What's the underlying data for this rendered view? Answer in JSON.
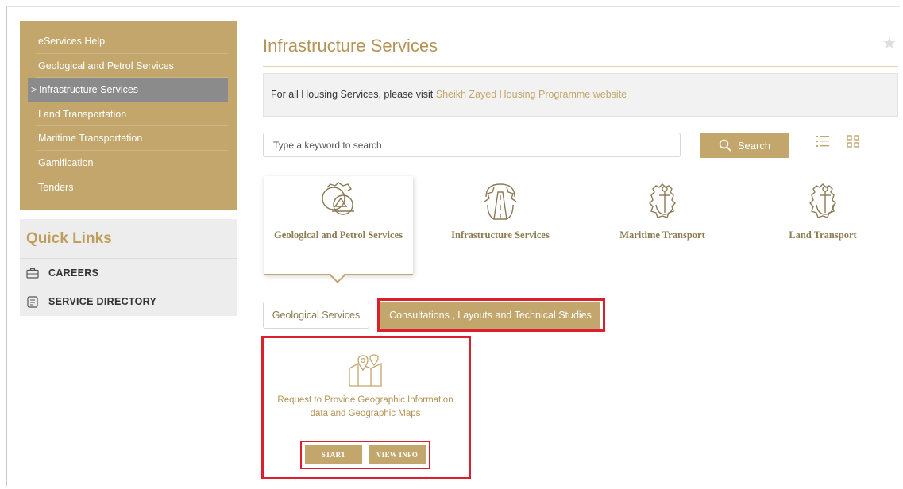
{
  "sidebar": {
    "items": [
      {
        "label": "eServices Help"
      },
      {
        "label": "Geological and Petrol Services"
      },
      {
        "label": "Infrastructure Services",
        "active": true
      },
      {
        "label": "Land Transportation"
      },
      {
        "label": "Maritime Transportation"
      },
      {
        "label": "Gamification"
      },
      {
        "label": "Tenders"
      }
    ],
    "active_marker": ">"
  },
  "quick_links": {
    "title": "Quick Links",
    "items": [
      {
        "label": "CAREERS",
        "icon": "briefcase-icon"
      },
      {
        "label": "SERVICE DIRECTORY",
        "icon": "document-icon"
      }
    ]
  },
  "main": {
    "title": "Infrastructure Services",
    "housing_notice": {
      "text": "For all Housing Services, please visit ",
      "link": "Sheikh Zayed Housing Programme website"
    },
    "search": {
      "placeholder": "Type a keyword to search",
      "button_label": "Search"
    },
    "categories": [
      {
        "label": "Geological and Petrol Services",
        "icon": "gear-dome-icon",
        "active": true
      },
      {
        "label": "Infrastructure Services",
        "icon": "gear-road-icon"
      },
      {
        "label": "Maritime Transport",
        "icon": "gear-anchor-icon"
      },
      {
        "label": "Land Transport",
        "icon": "gear-anchor-icon"
      }
    ],
    "tabs": [
      {
        "label": "Geological Services"
      },
      {
        "label": "Consultations , Layouts and Technical Studies",
        "active": true
      }
    ],
    "service_card": {
      "title_line1": "Request to Provide Geographic Information",
      "title_line2": "data and Geographic Maps",
      "start_label": "START",
      "info_label": "VIEW INFO"
    }
  },
  "colors": {
    "brand_gold": "#c2a66c",
    "active_grey": "#8b8b8b",
    "highlight_red": "#dc1f2d"
  }
}
